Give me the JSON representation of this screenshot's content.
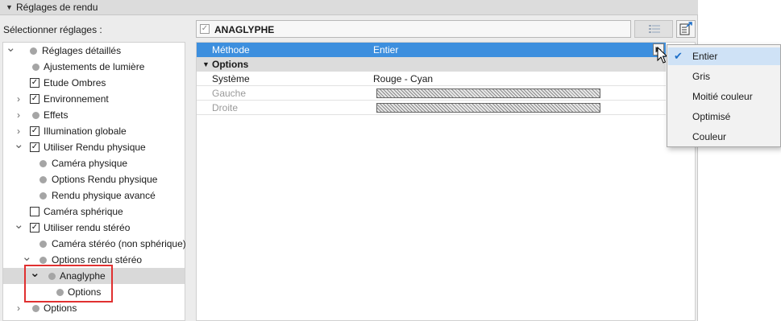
{
  "panel": {
    "title": "Réglages de rendu",
    "select_label": "Sélectionner réglages :"
  },
  "settings_set": {
    "name": "ANAGLYPHE",
    "checked": true
  },
  "tree": {
    "items": [
      {
        "label": "Réglages détaillés",
        "expanded": true,
        "marker": "dot",
        "level": 0
      },
      {
        "label": "Ajustements de lumière",
        "marker": "dot",
        "level": 1
      },
      {
        "label": "Etude Ombres",
        "marker": "checkbox",
        "checked": true,
        "level": 1
      },
      {
        "label": "Environnement",
        "marker": "checkbox",
        "checked": true,
        "expandable": true,
        "level": 1
      },
      {
        "label": "Effets",
        "marker": "dot",
        "expandable": true,
        "level": 1
      },
      {
        "label": "Illumination globale",
        "marker": "checkbox",
        "checked": true,
        "expandable": true,
        "level": 1
      },
      {
        "label": "Utiliser Rendu physique",
        "marker": "checkbox",
        "checked": true,
        "expanded": true,
        "level": 1
      },
      {
        "label": "Caméra physique",
        "marker": "dot",
        "level": 2
      },
      {
        "label": "Options Rendu physique",
        "marker": "dot",
        "level": 2
      },
      {
        "label": "Rendu physique avancé",
        "marker": "dot",
        "level": 2
      },
      {
        "label": "Caméra sphérique",
        "marker": "checkbox",
        "checked": false,
        "level": 1
      },
      {
        "label": "Utiliser rendu stéréo",
        "marker": "checkbox",
        "checked": true,
        "expanded": true,
        "level": 1
      },
      {
        "label": "Caméra stéréo (non sphérique)",
        "marker": "dot",
        "level": 2
      },
      {
        "label": "Options rendu stéréo",
        "marker": "dot",
        "expanded": true,
        "level": 2
      },
      {
        "label": "Anaglyphe",
        "marker": "dot",
        "expanded": true,
        "selected": true,
        "level": 3
      },
      {
        "label": "Options",
        "marker": "dot",
        "level": 4
      },
      {
        "label": "Options",
        "marker": "dot",
        "expandable": true,
        "level": 1
      }
    ]
  },
  "table": {
    "methode": {
      "label": "Méthode",
      "value": "Entier"
    },
    "group": {
      "label": "Options"
    },
    "rows": [
      {
        "label": "Système",
        "value": "Rouge - Cyan"
      },
      {
        "label": "Gauche",
        "value": ""
      },
      {
        "label": "Droite",
        "value": ""
      }
    ]
  },
  "dropdown": {
    "selected": "Entier",
    "options": [
      "Entier",
      "Gris",
      "Moitié couleur",
      "Optimisé",
      "Couleur"
    ]
  },
  "colors": {
    "selection_row": "#3d8fde",
    "highlight_box": "#e03030",
    "menu_checked_bg": "#cfe2f6"
  }
}
